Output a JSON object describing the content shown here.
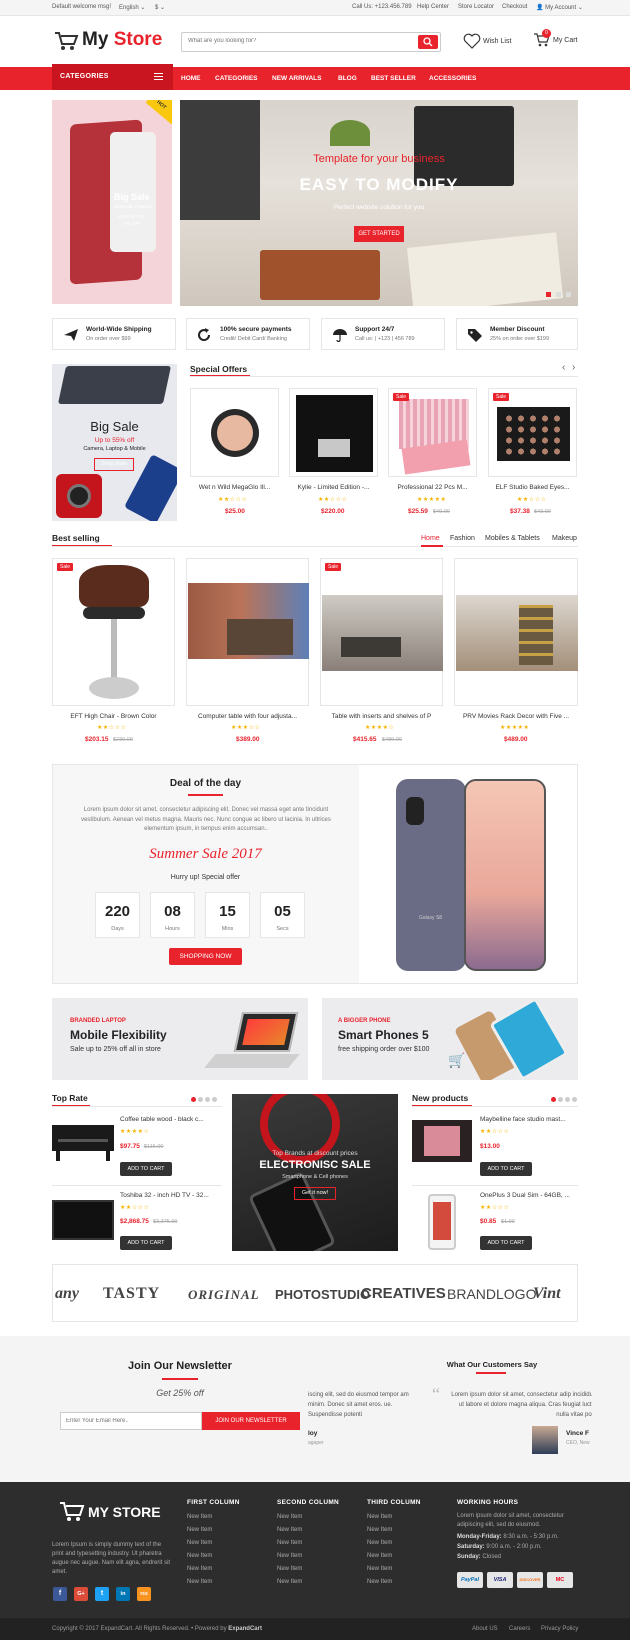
{
  "topbar": {
    "welcome": "Default welcome msg!",
    "language": "English ⌄",
    "currency": "$ ⌄",
    "call_us": "Call Us: +123.456.789",
    "help_center": "Help Center",
    "store_locator": "Store Locator",
    "checkout": "Checkout",
    "my_account": "My Account ⌄"
  },
  "header": {
    "logo_my": "My ",
    "logo_store": "Store",
    "search_placeholder": "What are you looking for?",
    "wishlist": "Wish List",
    "cart": "My Cart",
    "cart_count": "0"
  },
  "nav": {
    "categories_button": "CATEGORIES",
    "items": [
      "HOME",
      "CATEGORIES",
      "NEW ARRIVALS",
      "BLOG",
      "BEST SELLER",
      "ACCESSORIES"
    ]
  },
  "hero_side": {
    "badge": "HOT",
    "title": "Big Sale",
    "subtitle": "Bestseller Products",
    "line3": "SAVE UP TO",
    "line4": "70% OFF"
  },
  "hero": {
    "tagline": "Template for your business",
    "title": "EASY TO MODIFY",
    "subtitle": "Perfect website solution for you",
    "button": "GET STARTED"
  },
  "features": [
    {
      "title": "World-Wide Shipping",
      "sub": "On order over $99"
    },
    {
      "title": "100% secure payments",
      "sub": "Credit/ Debit Card/ Banking"
    },
    {
      "title": "Support 24/7",
      "sub": "Call us: | +123 | 456 789"
    },
    {
      "title": "Member Discount",
      "sub": "25% on order over $199"
    }
  ],
  "side_banner": {
    "title": "Big Sale",
    "sub1": "Up to 55% off",
    "sub2": "Camera, Laptop & Mobile",
    "button": "Shop Now"
  },
  "special_offers": {
    "title": "Special Offers",
    "prev": "‹",
    "next": "›",
    "products": [
      {
        "name": "Wet n Wild MegaGlo Ill...",
        "stars": "★★☆☆☆",
        "price": "$25.00",
        "old": "",
        "sale": ""
      },
      {
        "name": "Kylie - Limited Edition -...",
        "stars": "★★☆☆☆",
        "price": "$220.00",
        "old": "",
        "sale": ""
      },
      {
        "name": "Professional 22 Pcs M...",
        "stars": "★★★★★",
        "price": "$25.59",
        "old": "$40.00",
        "sale": "Sale"
      },
      {
        "name": "ELF Studio Baked Eyes...",
        "stars": "★★☆☆☆",
        "price": "$37.38",
        "old": "$43.00",
        "sale": "Sale"
      }
    ]
  },
  "best_selling": {
    "title": "Best selling",
    "tabs": [
      "Home",
      "Fashion",
      "Mobiles & Tablets",
      "Makeup"
    ],
    "products": [
      {
        "name": "EFT High Chair - Brown Color",
        "stars": "★★☆☆☆",
        "price": "$203.15",
        "old": "$239.00",
        "sale": "Sale"
      },
      {
        "name": "Computer table with four adjusta...",
        "stars": "★★★☆☆",
        "price": "$389.00",
        "old": "",
        "sale": ""
      },
      {
        "name": "Table with inserts and shelves of P",
        "stars": "★★★★☆",
        "price": "$415.65",
        "old": "$489.00",
        "sale": "Sale"
      },
      {
        "name": "PRV Movies Rack Decor with Five ...",
        "stars": "★★★★★",
        "price": "$489.00",
        "old": "",
        "sale": ""
      }
    ]
  },
  "deal": {
    "title": "Deal of the day",
    "desc": "Lorem ipsum dolor sit amet, consectetur adipiscing elit. Donec vel massa eget ante tincidunt vestibulum. Aenean vel metus magna. Mauris nec. Nunc congue ac libero ut lacinia. In ultrices elementum ipsum, in tempus enim accumsan..",
    "sale_title": "Summer Sale 2017",
    "hurry": "Hurry up! Special offer",
    "countdown": [
      {
        "n": "220",
        "l": "Days"
      },
      {
        "n": "08",
        "l": "Hours"
      },
      {
        "n": "15",
        "l": "Mins"
      },
      {
        "n": "05",
        "l": "Secs"
      }
    ],
    "button": "SHOPPING NOW",
    "phone_label": "Galaxy S8"
  },
  "promo": [
    {
      "kicker": "BRANDED LAPTOP",
      "title": "Mobile Flexibility",
      "sub": "Sale up to 25% off all in store"
    },
    {
      "kicker": "A BIGGER PHONE",
      "title": "Smart Phones 5",
      "sub": "free shipping order over $100"
    }
  ],
  "top_rate": {
    "title": "Top Rate",
    "products": [
      {
        "name": "Coffee table wood - black c...",
        "stars": "★★★★☆",
        "price": "$97.75",
        "old": "$115.00",
        "button": "ADD TO CART"
      },
      {
        "name": "Toshiba 32 - inch HD TV - 32...",
        "stars": "★★☆☆☆",
        "price": "$2,868.75",
        "old": "$3,375.00",
        "button": "ADD TO CART"
      }
    ]
  },
  "electronic": {
    "kicker": "Top Brands at discount prices",
    "title": "ELECTRONISC SALE",
    "sub": "Smartphone & Cell phones",
    "button": "Get it now!"
  },
  "new_products": {
    "title": "New products",
    "products": [
      {
        "name": "Maybelline face studio mast...",
        "stars": "★★☆☆☆",
        "price": "$13.00",
        "old": "",
        "button": "ADD TO CART"
      },
      {
        "name": "OnePlus 3 Dual Sim - 64GB, ...",
        "stars": "★★☆☆☆",
        "price": "$0.85",
        "old": "$1.00",
        "button": "ADD TO CART"
      }
    ]
  },
  "brands": [
    "any",
    "TASTY",
    "ORIGINAL",
    "PHOTOSTUDIO",
    "CREATIVES",
    "BRANDLOGO",
    "Vint"
  ],
  "newsletter": {
    "title": "Join Our Newsletter",
    "sub": "Get 25% off",
    "placeholder": "Enter Your Email Here..",
    "button": "JOIN OUR NEWSLETTER"
  },
  "testimonials": {
    "title": "What Our Customers Say",
    "left_text": "iscing elit, sed do eiusmod tempor am minim. Donec sit amet eros. ue. Suspendisse potenti",
    "left_name": "loy",
    "left_role": "agaper",
    "quote": "“",
    "text": "Lorem ipsum dolor sit amet, consectetur adip incididunt ut labore et dolore magna aliqua. Cras feugiat luctus nulla vitae posu",
    "name": "Vince F",
    "role": "CEO, New"
  },
  "footer": {
    "logo": "MY STORE",
    "about": "Lorem Ipsum is simply dummy text of the print and typesetting industry. Ut pharetra augue nec augue. Nam elit agna, endrerit sit amet.",
    "socials": [
      "f",
      "G+",
      "t",
      "in",
      "rss"
    ],
    "columns": [
      {
        "title": "FIRST COLUMN",
        "items": [
          "New Item",
          "New Item",
          "New Item",
          "New Item",
          "New Item",
          "New Item"
        ]
      },
      {
        "title": "SECOND COLUMN",
        "items": [
          "New Item",
          "New Item",
          "New Item",
          "New Item",
          "New Item",
          "New Item"
        ]
      },
      {
        "title": "THIRD COLUMN",
        "items": [
          "New Item",
          "New Item",
          "New Item",
          "New Item",
          "New Item",
          "New Item"
        ]
      }
    ],
    "hours_title": "WORKING HOURS",
    "hours_desc": "Lorem ipsum dolor sit amet, consectetur adipiscing elit, sed do eiusmod.",
    "hours": [
      {
        "day": "Monday-Friday:",
        "time": " 8:30 a.m. - 5:30 p.m."
      },
      {
        "day": "Saturday:",
        "time": " 9:00 a.m. - 2:00 p.m."
      },
      {
        "day": "Sunday:",
        "time": " Closed"
      }
    ],
    "payments": [
      "PayPal",
      "VISA",
      "DISCOVER",
      "MC"
    ],
    "copyright": "Copyright © 2017 ExpandCart. All Rights Reserved. • Powered by ",
    "powered": "ExpandCart",
    "links": [
      "About US",
      "Careers",
      "Privacy Policy"
    ]
  },
  "colors": {
    "accent": "#e8232c",
    "dark": "#2d2d2d"
  }
}
